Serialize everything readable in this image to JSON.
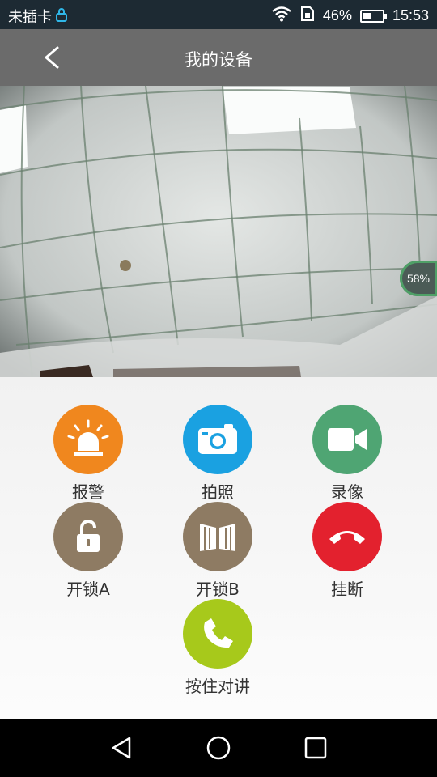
{
  "status_bar": {
    "carrier": "未插卡",
    "battery_percent": "46%",
    "battery_level": 0.46,
    "time": "15:53",
    "icons": [
      "lock-icon",
      "wifi-icon",
      "sim-icon",
      "battery-icon"
    ]
  },
  "header": {
    "back_icon": "chevron-left-icon",
    "title": "我的设备"
  },
  "camera": {
    "loading_percent": "58%"
  },
  "controls": [
    {
      "label": "报警",
      "icon": "alarm-light-icon",
      "color": "#f0871e"
    },
    {
      "label": "拍照",
      "icon": "camera-icon",
      "color": "#1aa1e1"
    },
    {
      "label": "录像",
      "icon": "video-camera-icon",
      "color": "#4fa573"
    },
    {
      "label": "开锁A",
      "icon": "unlock-icon",
      "color": "#8e7b63"
    },
    {
      "label": "开锁B",
      "icon": "gate-icon",
      "color": "#8e7b63"
    },
    {
      "label": "挂断",
      "icon": "hang-up-icon",
      "color": "#e3212e"
    },
    {
      "label": "按住对讲",
      "icon": "phone-icon",
      "color": "#a7c91b"
    }
  ],
  "nav_bar": [
    "back-triangle-icon",
    "home-circle-icon",
    "recents-square-icon"
  ]
}
